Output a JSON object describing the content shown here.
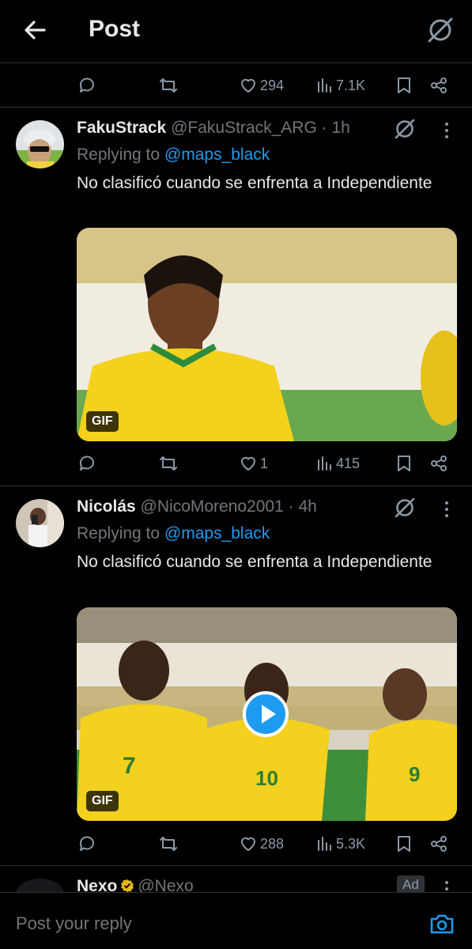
{
  "header": {
    "title": "Post"
  },
  "top_actions": {
    "likes": "294",
    "views": "7.1K"
  },
  "replies": [
    {
      "name": "FakuStrack",
      "handle": "@FakuStrack_ARG · 1h",
      "replying_label": "Replying to",
      "replying_to": "@maps_black",
      "text": "No clasificó cuando se enfrenta a Independiente",
      "gif_label": "GIF",
      "likes": "1",
      "views": "415"
    },
    {
      "name": "Nicolás",
      "handle": "@NicoMoreno2001 · 4h",
      "replying_label": "Replying to",
      "replying_to": "@maps_black",
      "text": "No clasificó cuando se enfrenta a Independiente",
      "gif_label": "GIF",
      "likes": "288",
      "views": "5.3K"
    }
  ],
  "ad": {
    "name": "Nexo",
    "handle": "@Nexo",
    "badge": "Ad"
  },
  "reply_bar": {
    "placeholder": "Post your reply"
  },
  "colors": {
    "accent": "#1d9bf0",
    "muted": "#71767b",
    "text": "#e7e9ea",
    "border": "#2f3336",
    "verified": "#e2b719"
  }
}
